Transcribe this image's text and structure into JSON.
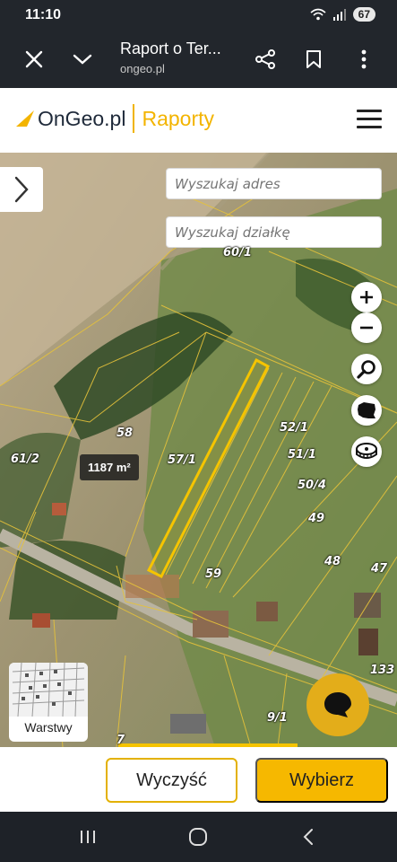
{
  "status": {
    "time": "11:10",
    "battery": "67"
  },
  "browser": {
    "title": "Raport o Ter...",
    "url": "ongeo.pl"
  },
  "header": {
    "logo": "OnGeo.pl",
    "section": "Raporty"
  },
  "map": {
    "search_address_placeholder": "Wyszukaj adres",
    "search_plot_placeholder": "Wyszukaj działkę",
    "area_label": "1187 m²",
    "plot_labels": [
      "60/1",
      "58",
      "61/2",
      "57/1",
      "52/1",
      "51/1",
      "50/4",
      "49",
      "48",
      "47",
      "59",
      "133",
      "9/1",
      "7"
    ],
    "layers_label": "Warstwy",
    "selection_color": "#f5c400",
    "boundary_color": "#e6c23a"
  },
  "actions": {
    "clear_label": "Wyczyść",
    "select_label": "Wybierz"
  }
}
